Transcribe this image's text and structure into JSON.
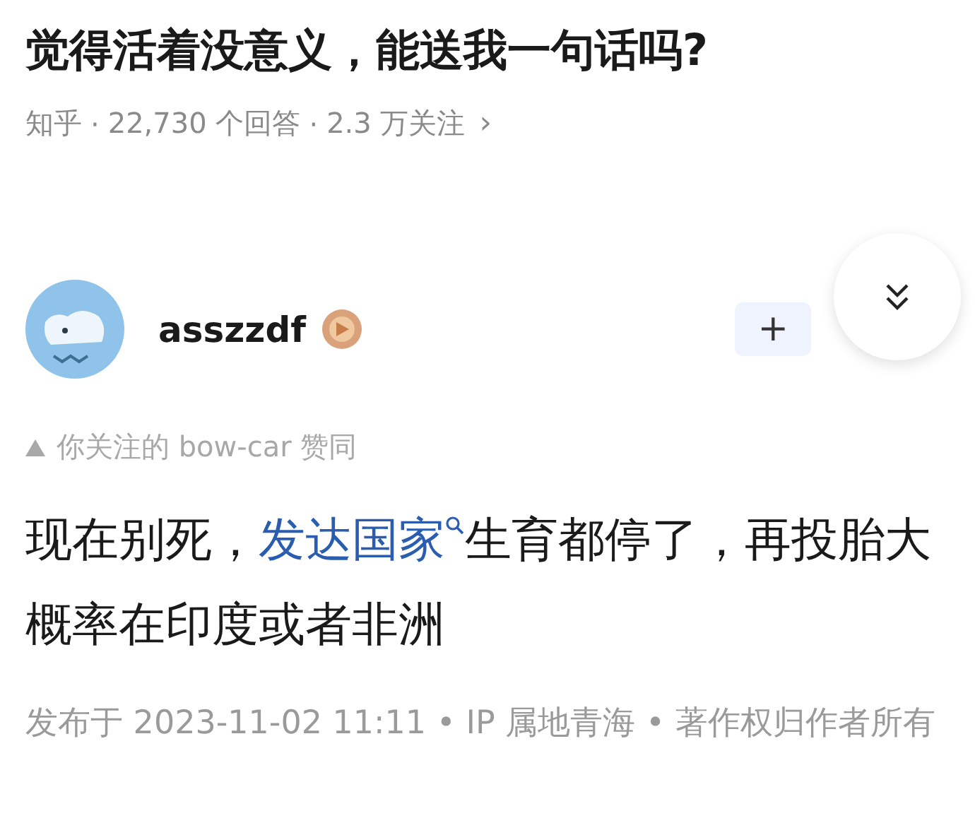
{
  "question": {
    "title": "觉得活着没意义，能送我一句话吗?",
    "meta": [
      {
        "text": "知乎"
      },
      {
        "text": "22,730 个回答"
      },
      {
        "text": "2.3 万关注"
      }
    ],
    "separator": "·",
    "chevron": "›"
  },
  "author": {
    "name": "asszzdf",
    "follow_label": "+"
  },
  "recommendation": "你关注的 bow-car 赞同",
  "answer": {
    "before": "现在别死，",
    "link": "发达国家",
    "after": "生育都停了，再投胎大概率在印度或者非洲"
  },
  "footer": "发布于 2023-11-02 11:11 • IP 属地青海 • 著作权归作者所有"
}
